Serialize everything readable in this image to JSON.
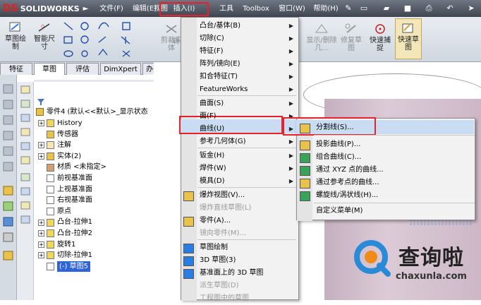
{
  "app": {
    "brand_prefix": "DS",
    "brand": "SOLIDWORKS"
  },
  "menubar": {
    "items": [
      {
        "label": "文件(F)"
      },
      {
        "label": "编辑(E)"
      },
      {
        "label": "视图"
      },
      {
        "label": "插入(I)"
      },
      {
        "label": "工具"
      },
      {
        "label": "Toolbox"
      },
      {
        "label": "窗口(W)"
      },
      {
        "label": "帮助(H)"
      }
    ]
  },
  "ribbon": {
    "sketch_label": "草图绘制",
    "smart_dim_label": "智能尺寸",
    "convert_label": "剪裁实体",
    "convert2_label": "转",
    "show_hide_label": "显示/删除几...",
    "repair_label": "修复草图",
    "quick_snap_label": "快速捕捉",
    "quick_sketch_label": "快速草图"
  },
  "tabs": [
    {
      "label": "特征"
    },
    {
      "label": "草图"
    },
    {
      "label": "评估"
    },
    {
      "label": "DimXpert"
    },
    {
      "label": "办公室产品"
    }
  ],
  "tree": {
    "root": "零件4 (默认<<默认>_显示状态",
    "items": [
      {
        "label": "History",
        "exp": "+"
      },
      {
        "label": "传感器",
        "exp": ""
      },
      {
        "label": "注解",
        "exp": "+"
      },
      {
        "label": "实体(2)",
        "exp": "+"
      },
      {
        "label": "材质 <未指定>",
        "exp": ""
      },
      {
        "label": "前视基准面",
        "exp": ""
      },
      {
        "label": "上视基准面",
        "exp": ""
      },
      {
        "label": "右视基准面",
        "exp": ""
      },
      {
        "label": "原点",
        "exp": ""
      },
      {
        "label": "凸台-拉伸1",
        "exp": "+"
      },
      {
        "label": "凸台-拉伸2",
        "exp": "+"
      },
      {
        "label": "旋转1",
        "exp": "+"
      },
      {
        "label": "切除-拉伸1",
        "exp": "+"
      },
      {
        "label": "(-) 草图5",
        "exp": ""
      }
    ]
  },
  "insert_menu": {
    "items": [
      {
        "label": "凸台/基体(B)",
        "sub": true
      },
      {
        "label": "切除(C)",
        "sub": true
      },
      {
        "label": "特征(F)",
        "sub": true
      },
      {
        "label": "阵列/镜向(E)",
        "sub": true
      },
      {
        "label": "扣合特征(T)",
        "sub": true
      },
      {
        "label": "FeatureWorks",
        "sub": true
      },
      {
        "label": "曲面(S)",
        "sub": true
      },
      {
        "label": "面(F)",
        "sub": true
      },
      {
        "label": "曲线(U)",
        "sub": true
      },
      {
        "label": "参考几何体(G)",
        "sub": true
      },
      {
        "label": "钣金(H)",
        "sub": true
      },
      {
        "label": "焊件(W)",
        "sub": true
      },
      {
        "label": "模具(D)",
        "sub": true
      },
      {
        "label": "爆炸视图(V)..."
      },
      {
        "label": "爆炸直线草图(L)",
        "dis": true
      },
      {
        "label": "零件(A)..."
      },
      {
        "label": "镜向零件(M)...",
        "dis": true
      },
      {
        "label": "草图绘制"
      },
      {
        "label": "3D 草图(3)"
      },
      {
        "label": "基准面上的 3D 草图"
      },
      {
        "label": "派生草图(D)",
        "dis": true
      },
      {
        "label": "工程图中的草图",
        "dis": true
      }
    ]
  },
  "curve_menu": {
    "items": [
      {
        "label": "分割线(S)..."
      },
      {
        "label": "投影曲线(P)..."
      },
      {
        "label": "组合曲线(C)..."
      },
      {
        "label": "通过 XYZ 点的曲线..."
      },
      {
        "label": "通过参考点的曲线..."
      },
      {
        "label": "螺旋线/涡状线(H)..."
      },
      {
        "label": "自定义菜单(M)"
      }
    ]
  },
  "watermark": {
    "text": "查询啦",
    "url": "chaxunla.com"
  },
  "colors": {
    "highlight": "#e8222a",
    "menu_hover": "#c9dcf2",
    "selected_tree": "#2f64d6"
  }
}
